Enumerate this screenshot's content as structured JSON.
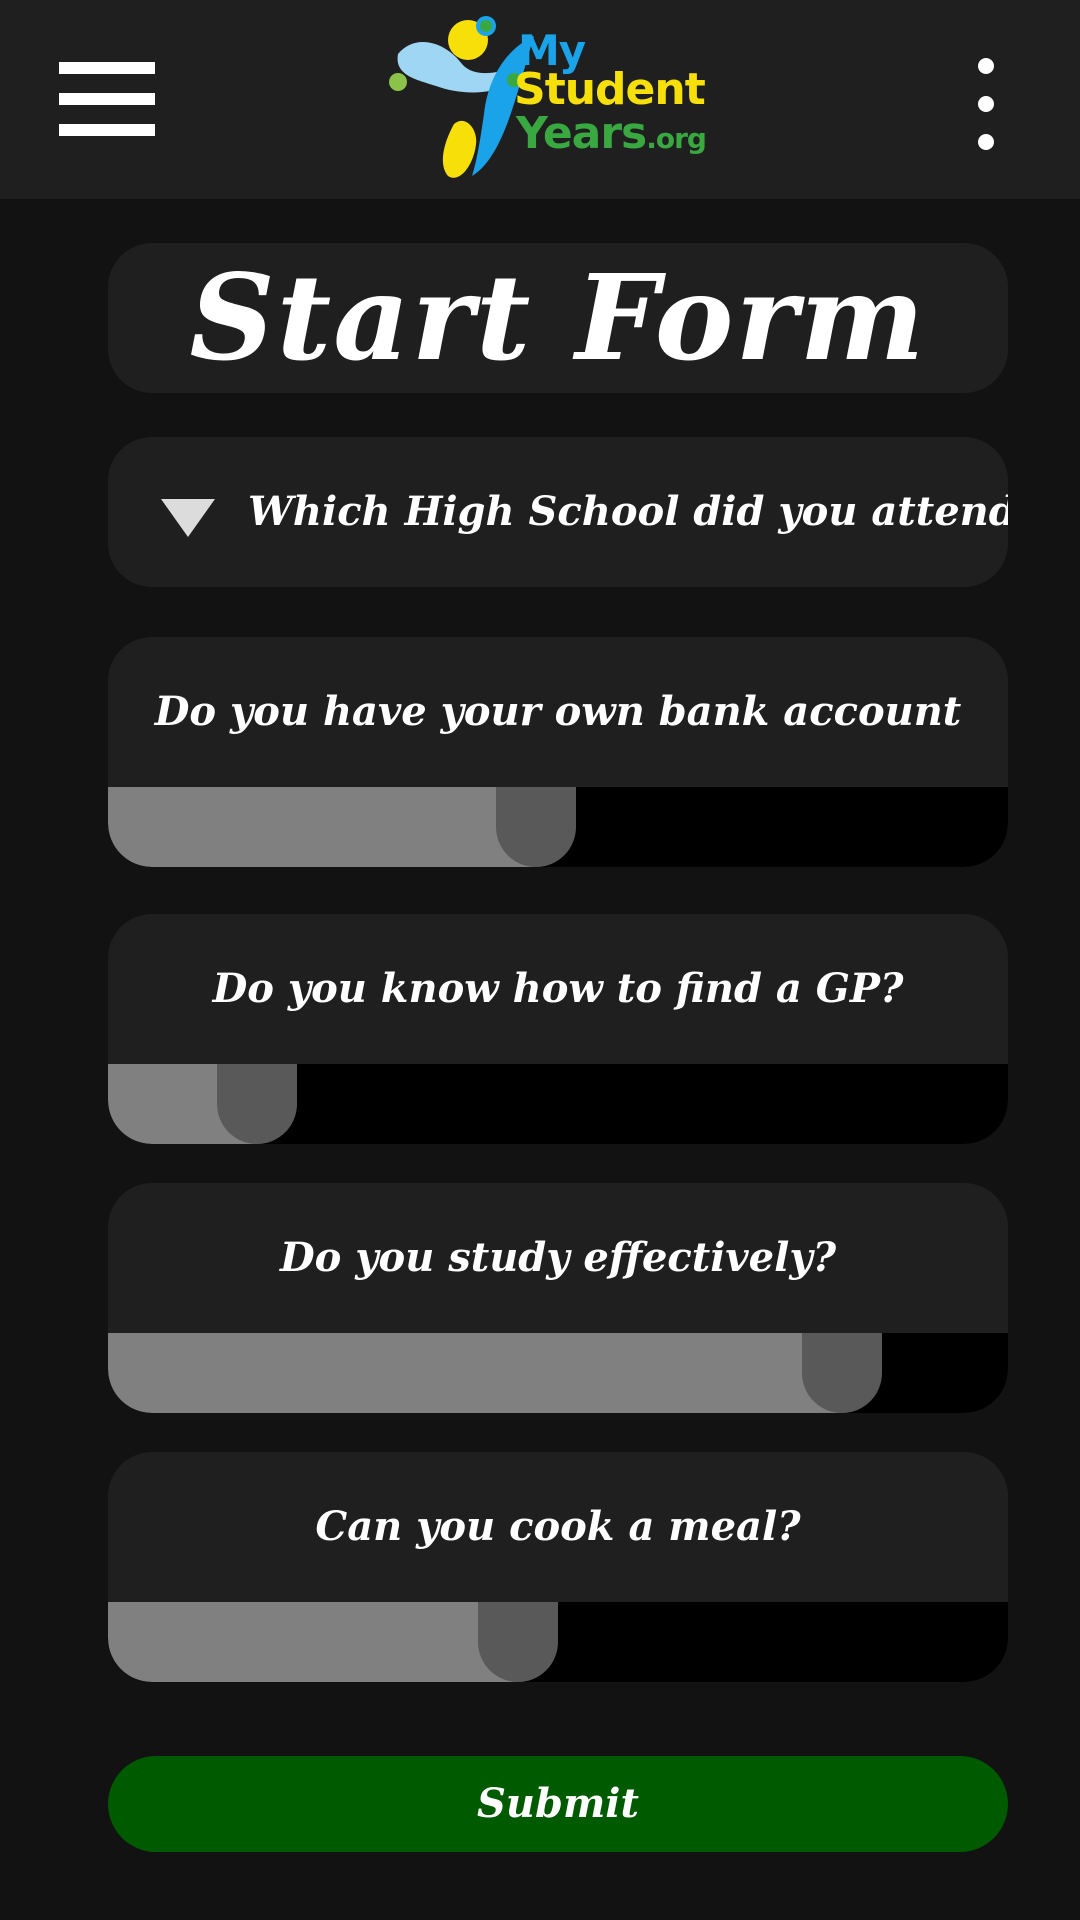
{
  "header": {
    "menu_icon": "hamburger-menu-icon",
    "more_icon": "more-vertical-icon",
    "logo": {
      "my": "My",
      "student": "Student",
      "years": "Years",
      "domain": ".org",
      "colors": {
        "blue": "#1aa3e8",
        "yellow": "#f7e00a",
        "green": "#3aa841",
        "light_blue": "#9fd6f3"
      }
    }
  },
  "form": {
    "title": "Start Form",
    "school_select": {
      "icon": "dropdown-triangle-icon",
      "label": "Which High School did you attend"
    },
    "questions": [
      {
        "label": "Do you have your own bank account",
        "value_fraction": 0.52
      },
      {
        "label": "Do you know how to find a GP?",
        "value_fraction": 0.21
      },
      {
        "label": "Do you study effectively?",
        "value_fraction": 0.86
      },
      {
        "label": "Can you cook a meal?",
        "value_fraction": 0.5
      }
    ],
    "submit_label": "Submit"
  },
  "colors": {
    "background": "#121212",
    "card": "#1f1f1f",
    "slider_fill": "#808080",
    "slider_thumb": "#595959",
    "slider_track": "#000000",
    "submit": "#005a00"
  }
}
